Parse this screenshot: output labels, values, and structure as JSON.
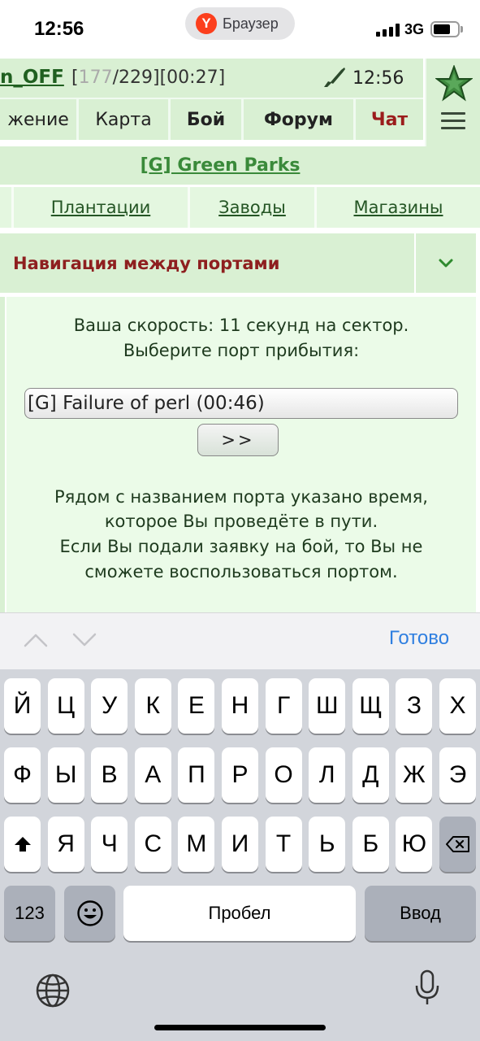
{
  "status_bar": {
    "time": "12:56",
    "browser_name": "Браузер",
    "browser_logo": "Y",
    "network": "3G",
    "battery_level": 0.7
  },
  "game_header": {
    "username": "n_OFF",
    "stats_open": "[",
    "current": "177",
    "stats_rest": "/229][00:27]",
    "time": "12:56",
    "icons": [
      "rifle-icon",
      "star-icon",
      "menu-icon"
    ]
  },
  "nav": {
    "items": [
      "жение",
      "Карта",
      "Бой",
      "Форум",
      "Чат"
    ]
  },
  "location": {
    "link": "[G] Green Parks"
  },
  "subnav": {
    "items": [
      "Плантации",
      "Заводы",
      "Магазины"
    ]
  },
  "panel": {
    "title": "Навигация между портами",
    "speed_text": "Ваша скорость: 11 секунд на сектор.",
    "choose_text": "Выберите порт прибытия:",
    "port_selected": "[G] Failure of perl (00:46)",
    "go_label": ">>",
    "note_lines": [
      "Рядом с названием порта указано время,",
      "которое Вы проведёте в пути.",
      "Если Вы подали заявку на бой, то Вы не",
      "сможете воспользоваться портом."
    ],
    "colors": {
      "panel_bg": "#d9f0d3",
      "title": "#8e1f1f",
      "link": "#3a8a3a"
    }
  },
  "accessory": {
    "done_label": "Готово"
  },
  "keyboard": {
    "row1": [
      "Й",
      "Ц",
      "У",
      "К",
      "Е",
      "Н",
      "Г",
      "Ш",
      "Щ",
      "З",
      "Х"
    ],
    "row2": [
      "Ф",
      "Ы",
      "В",
      "А",
      "П",
      "Р",
      "О",
      "Л",
      "Д",
      "Ж",
      "Э"
    ],
    "row3": [
      "Я",
      "Ч",
      "С",
      "М",
      "И",
      "Т",
      "Ь",
      "Б",
      "Ю"
    ],
    "numbers_label": "123",
    "space_label": "Пробел",
    "enter_label": "Ввод"
  }
}
